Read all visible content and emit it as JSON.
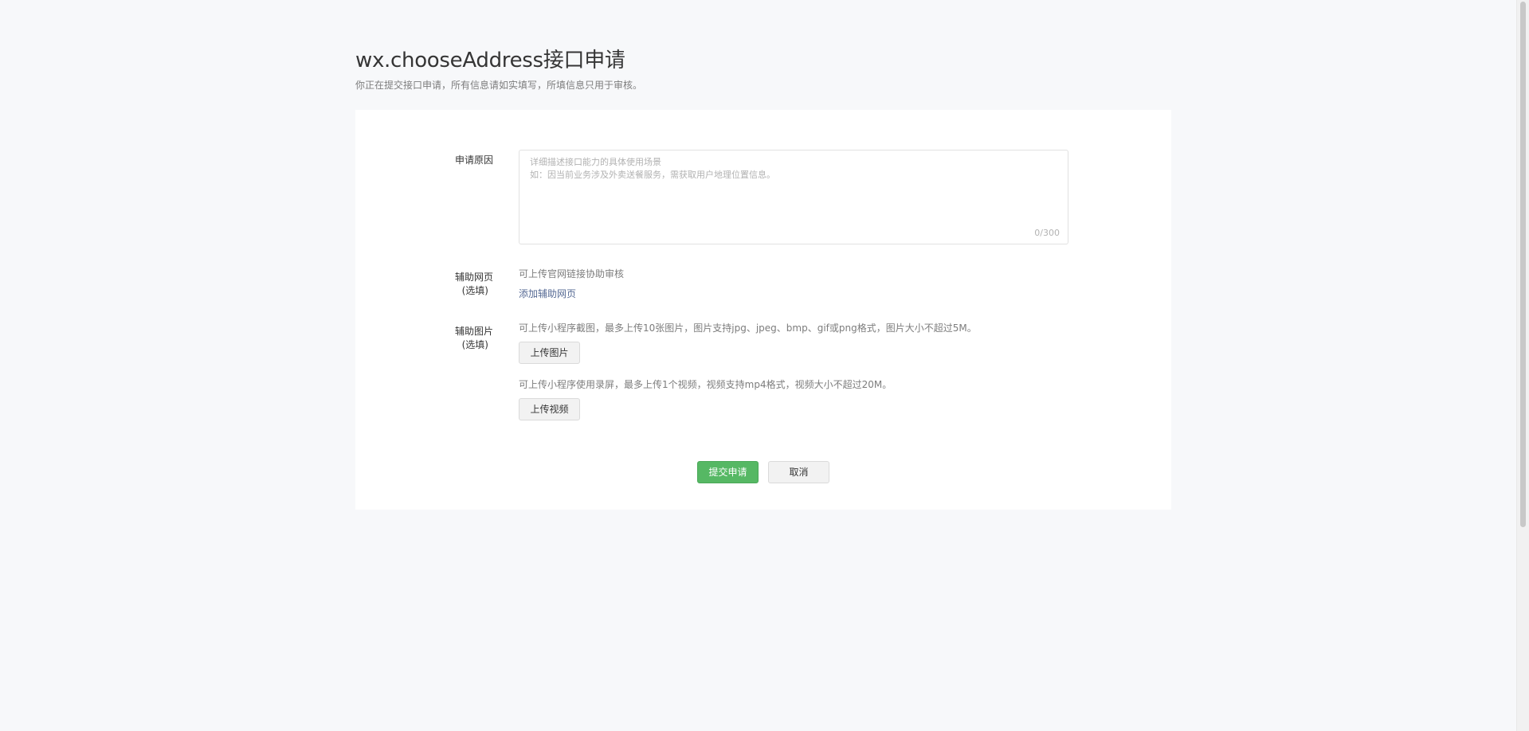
{
  "header": {
    "title": "wx.chooseAddress接口申请",
    "subtitle": "你正在提交接口申请，所有信息请如实填写，所填信息只用于审核。"
  },
  "form": {
    "reason": {
      "label": "申请原因",
      "value": "",
      "placeholder": "详细描述接口能力的具体使用场景\n如：因当前业务涉及外卖送餐服务，需获取用户地理位置信息。",
      "counter": "0/300"
    },
    "webpage": {
      "label": "辅助网页",
      "label_sub": "(选填)",
      "hint": "可上传官网链接协助审核",
      "link": "添加辅助网页"
    },
    "images": {
      "label": "辅助图片",
      "label_sub": "(选填)",
      "image_hint": "可上传小程序截图，最多上传10张图片，图片支持jpg、jpeg、bmp、gif或png格式，图片大小不超过5M。",
      "image_button": "上传图片",
      "video_hint": "可上传小程序使用录屏，最多上传1个视频，视频支持mp4格式，视频大小不超过20M。",
      "video_button": "上传视频"
    }
  },
  "actions": {
    "submit_label": "提交申请",
    "cancel_label": "取消"
  },
  "colors": {
    "primary": "#56b864",
    "link": "#576b95",
    "page_bg": "#f7f8fa"
  }
}
